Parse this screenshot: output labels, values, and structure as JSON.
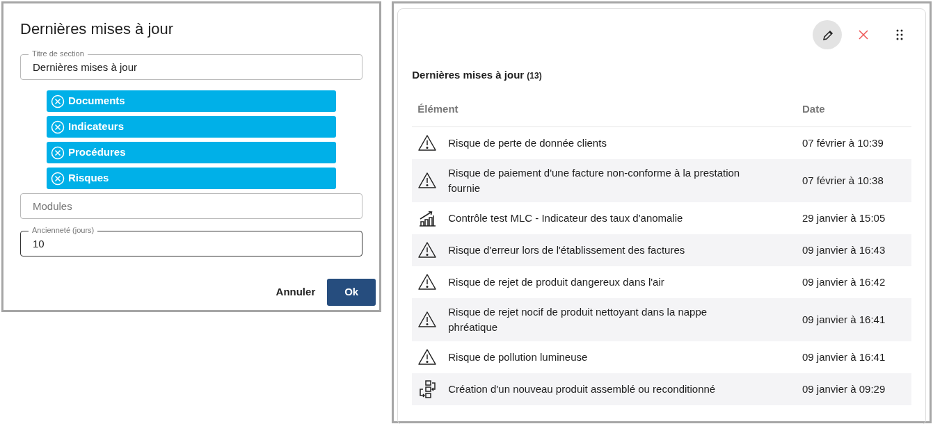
{
  "dialog": {
    "title": "Dernières mises à jour",
    "section_title_field": {
      "label": "Titre de section",
      "value": "Dernières mises à jour"
    },
    "chips": [
      {
        "label": "Documents"
      },
      {
        "label": "Indicateurs"
      },
      {
        "label": "Procédures"
      },
      {
        "label": "Risques"
      }
    ],
    "modules_field": {
      "placeholder": "Modules"
    },
    "age_field": {
      "label": "Ancienneté (jours)",
      "value": "10",
      "focused": true
    },
    "buttons": [
      {
        "label": "Annuler",
        "kind": "text"
      },
      {
        "label": "Ok",
        "kind": "primary"
      }
    ]
  },
  "widget": {
    "toolbar": [
      {
        "kind": "edit",
        "selected": true
      },
      {
        "kind": "delete",
        "selected": false
      },
      {
        "kind": "drag",
        "selected": false
      }
    ],
    "title": "Dernières mises à jour",
    "count": "(13)",
    "table": {
      "columns": [
        "Élément",
        "Date"
      ],
      "rows": [
        {
          "kind": "risk",
          "element": "Risque de perte de donnée clients",
          "date": "07 février à 10:39"
        },
        {
          "kind": "risk",
          "element": "Risque de paiement d'une facture non-conforme à la prestation fournie",
          "date": "07 février à 10:38"
        },
        {
          "kind": "indicator",
          "element": "Contrôle test MLC - Indicateur des taux d'anomalie",
          "date": "29 janvier à 15:05"
        },
        {
          "kind": "risk",
          "element": "Risque d'erreur lors de l'établissement des factures",
          "date": "09 janvier à 16:43"
        },
        {
          "kind": "risk",
          "element": "Risque de rejet de produit dangereux dans l'air",
          "date": "09 janvier à 16:42"
        },
        {
          "kind": "risk",
          "element": "Risque de rejet nocif de produit nettoyant dans la nappe phréatique",
          "date": "09 janvier à 16:41"
        },
        {
          "kind": "risk",
          "element": "Risque de pollution lumineuse",
          "date": "09 janvier à 16:41"
        },
        {
          "kind": "procedure",
          "element": "Création d'un nouveau produit assemblé ou reconditionné",
          "date": "09 janvier à 09:29"
        }
      ]
    }
  }
}
